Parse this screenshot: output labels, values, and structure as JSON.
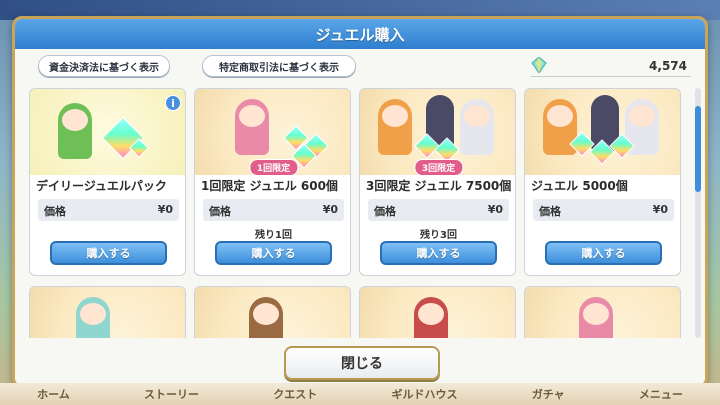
{
  "dialog": {
    "title": "ジュエル購入",
    "link_funds": "資金決済法に基づく表示",
    "link_commerce": "特定商取引法に基づく表示",
    "balance": "4,574",
    "close_label": "閉じる"
  },
  "products": [
    {
      "name": "デイリージュエルパック",
      "price_label": "価格",
      "price": "¥0",
      "badge": "",
      "remaining": "",
      "buy_label": "購入する"
    },
    {
      "name": "1回限定 ジュエル 600個",
      "price_label": "価格",
      "price": "¥0",
      "badge": "1回限定",
      "remaining": "残り1回",
      "buy_label": "購入する"
    },
    {
      "name": "3回限定 ジュエル 7500個",
      "price_label": "価格",
      "price": "¥0",
      "badge": "3回限定",
      "remaining": "残り3回",
      "buy_label": "購入する"
    },
    {
      "name": "ジュエル 5000個",
      "price_label": "価格",
      "price": "¥0",
      "badge": "",
      "remaining": "",
      "buy_label": "購入する"
    }
  ],
  "background_nav": [
    "ホーム",
    "ストーリー",
    "クエスト",
    "ギルドハウス",
    "ガチャ",
    "メニュー"
  ],
  "icons": {
    "info": "i",
    "gem": "jewel-icon"
  },
  "colors": {
    "title_bar": "#2f7fcf",
    "buy_button": "#3d8fdb",
    "badge": "#e25d89",
    "frame": "#c9a55a"
  }
}
